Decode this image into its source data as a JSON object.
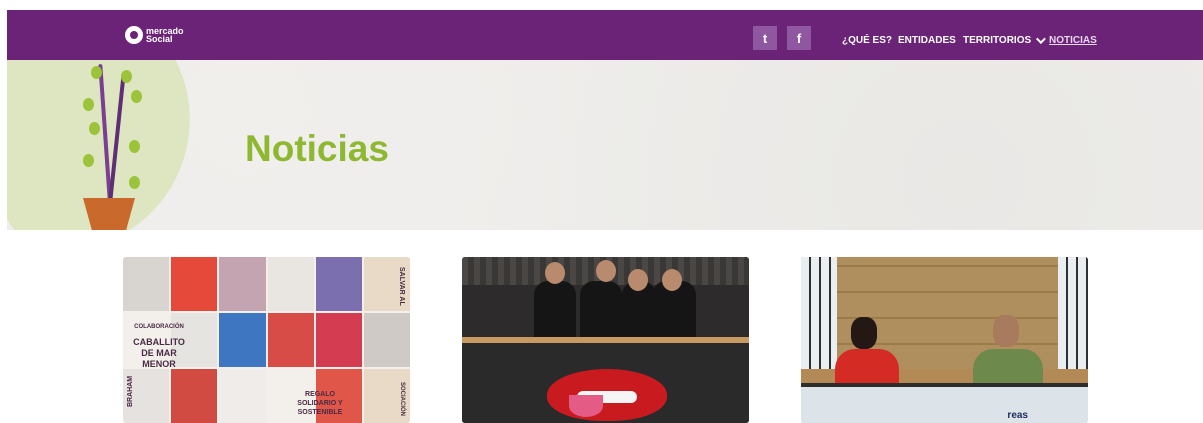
{
  "header": {
    "logo_line1": "mercado",
    "logo_line2": "Social",
    "social": {
      "twitter": "t",
      "facebook": "f"
    },
    "nav": {
      "que_es": "¿QUÉ ES?",
      "entidades": "ENTIDADES",
      "territorios": "TERRITORIOS",
      "noticias": "NOTICIAS"
    }
  },
  "hero": {
    "title": "Noticias"
  },
  "cards": {
    "card1": {
      "colaboracion": "COLABORACIÓN",
      "headline": "CABALLITO DE MAR MENOR",
      "regalo": "REGALO SOLIDARIO Y SOSTENIBLE",
      "side_top": "SALVAR AL",
      "side_left": "BRAHAM",
      "side_right": "SOCIACIÓN"
    },
    "card3": {
      "logo": "reas"
    }
  },
  "colors": {
    "header_bg": "#6b2378",
    "title_green": "#8fb832",
    "social_bg": "#8e57a0"
  }
}
